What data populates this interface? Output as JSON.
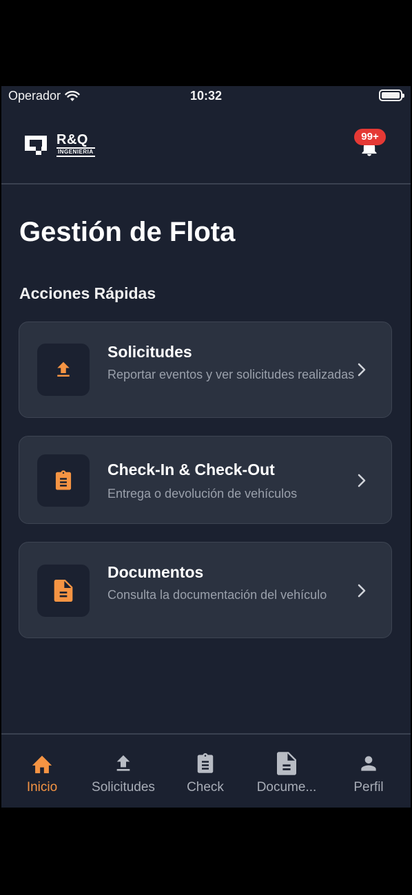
{
  "status_bar": {
    "carrier": "Operador",
    "time": "10:32"
  },
  "header": {
    "logo": {
      "title": "R&Q",
      "subtitle": "INGENIERIA"
    },
    "notifications": {
      "badge": "99+"
    }
  },
  "page": {
    "title": "Gestión de Flota",
    "section_title": "Acciones Rápidas"
  },
  "cards": [
    {
      "title": "Solicitudes",
      "description": "Reportar eventos y ver solicitudes realizadas",
      "icon": "upload-icon"
    },
    {
      "title": "Check-In & Check-Out",
      "description": "Entrega o devolución de vehículos",
      "icon": "clipboard-icon"
    },
    {
      "title": "Documentos",
      "description": "Consulta la documentación del vehículo",
      "icon": "document-icon"
    }
  ],
  "tabs": [
    {
      "label": "Inicio",
      "icon": "home-icon",
      "active": true
    },
    {
      "label": "Solicitudes",
      "icon": "upload-icon",
      "active": false
    },
    {
      "label": "Check",
      "icon": "clipboard-icon",
      "active": false
    },
    {
      "label": "Docume...",
      "icon": "document-icon",
      "active": false
    },
    {
      "label": "Perfil",
      "icon": "person-icon",
      "active": false
    }
  ],
  "colors": {
    "accent": "#f59443",
    "background": "#1b2130",
    "card": "#2b3240",
    "badge": "#e53935",
    "inactive": "#a8adb7"
  }
}
